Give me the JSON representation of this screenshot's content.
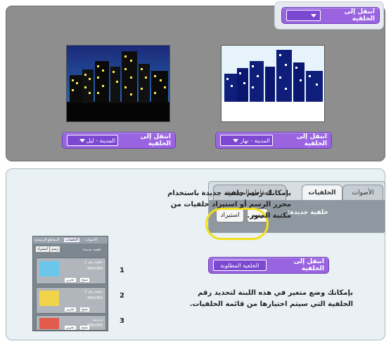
{
  "top": {
    "header_block": {
      "label": "انتقل إلى الخلفية",
      "value": ""
    },
    "left_block": {
      "label": "انتقل إلى الخلفية",
      "value": "المدينة - ليل"
    },
    "right_block": {
      "label": "انتقل إلى الخلفية",
      "value": "المدينة - نهار"
    }
  },
  "tabs": {
    "sounds": "الأصوات",
    "backdrops": "الخلفيات",
    "scripts": "المقاطع البرمجية",
    "new_backdrop_label": "خلفية جديدة:",
    "paint_button": "رسم",
    "import_button": "استيراد"
  },
  "text": {
    "paint_help": "بإمكانك رسم خلفية جديدة باستخدام محرر الرسم أو استيراد خلفيات من مكتبة الصور.",
    "variable_help": "بإمكانك وضع متغير في هذه اللبنة لتحديد رقم الخلفية التي سيتم اختيارها من قائمة الخلفيات."
  },
  "variable_block": {
    "label": "انتقل إلى الخلفية",
    "value": "الخلفية المطلوبة"
  },
  "mini_ui": {
    "tab_sounds": "الأصوات",
    "tab_backdrops": "الخلفيات",
    "tab_scripts": "المقاطع البرمجية",
    "new_label": "خلفية جديدة:",
    "paint": "رسم",
    "import": "استيراد",
    "rows": [
      {
        "num": "1",
        "name": "خلفية رقم 1",
        "size": "480x360",
        "kb": "",
        "edit": "تحرير",
        "copy": "نسخ"
      },
      {
        "num": "2",
        "name": "خلفية رقم 2",
        "size": "480x360",
        "kb": "",
        "edit": "تحرير",
        "copy": "نسخ"
      },
      {
        "num": "3",
        "name": "مدرسة",
        "size": "480x360",
        "kb": "",
        "edit": "تحرير",
        "copy": "نسخ"
      }
    ]
  },
  "colors": {
    "block_purple": "#9a64e0",
    "orange": "#f07a22",
    "highlight_yellow": "#f0e01a"
  }
}
